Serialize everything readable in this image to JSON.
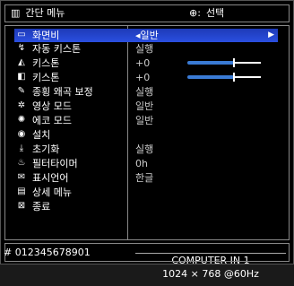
{
  "header": {
    "title": "간단 메뉴",
    "select_hint": "선택"
  },
  "menu": {
    "items": [
      {
        "icon": "aspect-icon",
        "glyph": "▭",
        "label": "화면비",
        "value": "◂일반",
        "selected": true
      },
      {
        "icon": "auto-keystone-icon",
        "glyph": "↯",
        "label": "자동 키스톤",
        "value": "실행"
      },
      {
        "icon": "keystone-v-icon",
        "glyph": "◭",
        "label": "키스톤",
        "value": "+0",
        "slider": true
      },
      {
        "icon": "keystone-h-icon",
        "glyph": "◧",
        "label": "키스톤",
        "value": "+0",
        "slider": true
      },
      {
        "icon": "perfect-fit-icon",
        "glyph": "✎",
        "label": "종횡 왜곡 보정",
        "value": "실행"
      },
      {
        "icon": "picture-mode-icon",
        "glyph": "✲",
        "label": "영상 모드",
        "value": "일반"
      },
      {
        "icon": "eco-mode-icon",
        "glyph": "✺",
        "label": "에코 모드",
        "value": "일반"
      },
      {
        "icon": "install-icon",
        "glyph": "◉",
        "label": "설치",
        "value": ""
      },
      {
        "icon": "reset-icon",
        "glyph": "⤓",
        "label": "초기화",
        "value": "실행"
      },
      {
        "icon": "filter-timer-icon",
        "glyph": "♨",
        "label": "필터타이머",
        "value": "0h"
      },
      {
        "icon": "language-icon",
        "glyph": "✉",
        "label": "표시언어",
        "value": "한글"
      },
      {
        "icon": "advanced-menu-icon",
        "glyph": "▤",
        "label": "상세 메뉴",
        "value": ""
      },
      {
        "icon": "exit-icon",
        "glyph": "⊠",
        "label": "종료",
        "value": ""
      }
    ]
  },
  "status": {
    "serial": "# 012345678901",
    "input_name": "COMPUTER IN 1",
    "input_signal": "1024 × 768 @60Hz"
  },
  "colors": {
    "selection": "#2a4fe0",
    "slider": "#3a7bd5"
  }
}
